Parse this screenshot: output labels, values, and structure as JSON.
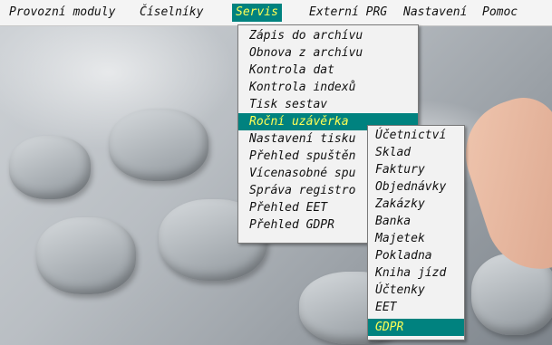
{
  "menubar": [
    {
      "label": "Provozní moduly"
    },
    {
      "label": "Číselníky"
    },
    {
      "label": "Servis"
    },
    {
      "label": "Externí PRG"
    },
    {
      "label": "Nastavení"
    },
    {
      "label": "Pomoc"
    }
  ],
  "servis_menu": [
    {
      "label": "Zápis do archívu"
    },
    {
      "label": "Obnova z archívu"
    },
    {
      "label": "Kontrola dat"
    },
    {
      "label": "Kontrola indexů"
    },
    {
      "label": "Tisk sestav"
    },
    {
      "label": "Roční uzávěrka",
      "selected": true
    },
    {
      "label": "Nastavení tisku"
    },
    {
      "label": "Přehled spuštěn"
    },
    {
      "label": "Vícenasobné spu"
    },
    {
      "label": "Správa registro"
    },
    {
      "label": "Přehled EET"
    },
    {
      "label": "Přehled GDPR"
    }
  ],
  "submenu": [
    {
      "label": "Účetnictví"
    },
    {
      "label": "Sklad"
    },
    {
      "label": "Faktury"
    },
    {
      "label": "Objednávky"
    },
    {
      "label": "Zakázky"
    },
    {
      "label": "Banka"
    },
    {
      "label": "Majetek"
    },
    {
      "label": "Pokladna"
    },
    {
      "label": "Kniha jízd"
    },
    {
      "label": "Účtenky"
    },
    {
      "label": "EET"
    },
    {
      "label": "GDPR",
      "selected": true
    }
  ],
  "colors": {
    "highlight": "#00827f",
    "highlight_text": "#ffff55"
  }
}
